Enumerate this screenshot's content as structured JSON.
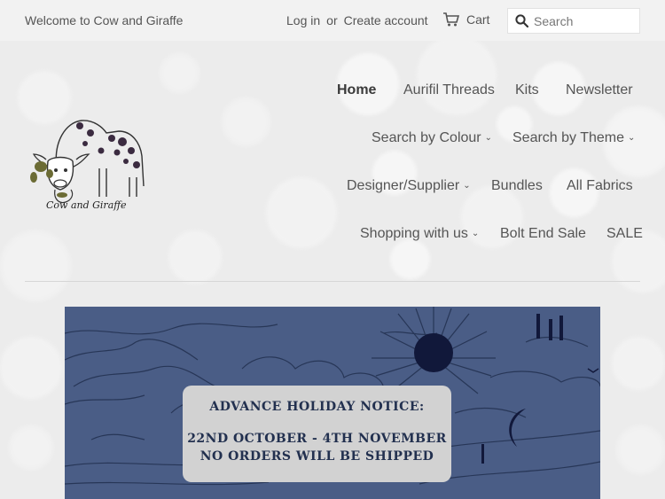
{
  "topbar": {
    "welcome": "Welcome to Cow and Giraffe",
    "login": "Log in",
    "or": "or",
    "create_account": "Create account",
    "cart": "Cart",
    "search_placeholder": "Search"
  },
  "logo": {
    "text": "Cow and Giraffe"
  },
  "nav": {
    "home": "Home",
    "aurifil": "Aurifil Threads",
    "kits": "Kits",
    "newsletter": "Newsletter",
    "search_colour": "Search by Colour",
    "search_theme": "Search by Theme",
    "designer": "Designer/Supplier",
    "bundles": "Bundles",
    "all_fabrics": "All Fabrics",
    "shopping": "Shopping with us",
    "bolt_end": "Bolt End Sale",
    "sale": "SALE"
  },
  "banner": {
    "line1": "ADVANCE HOLIDAY NOTICE:",
    "line2": "22ND OCTOBER - 4TH NOVEMBER",
    "line3": "NO ORDERS WILL BE SHIPPED"
  },
  "colors": {
    "banner_bg": "#4a5d86",
    "notice_bg": "#d2d2d2",
    "text": "#555555"
  }
}
